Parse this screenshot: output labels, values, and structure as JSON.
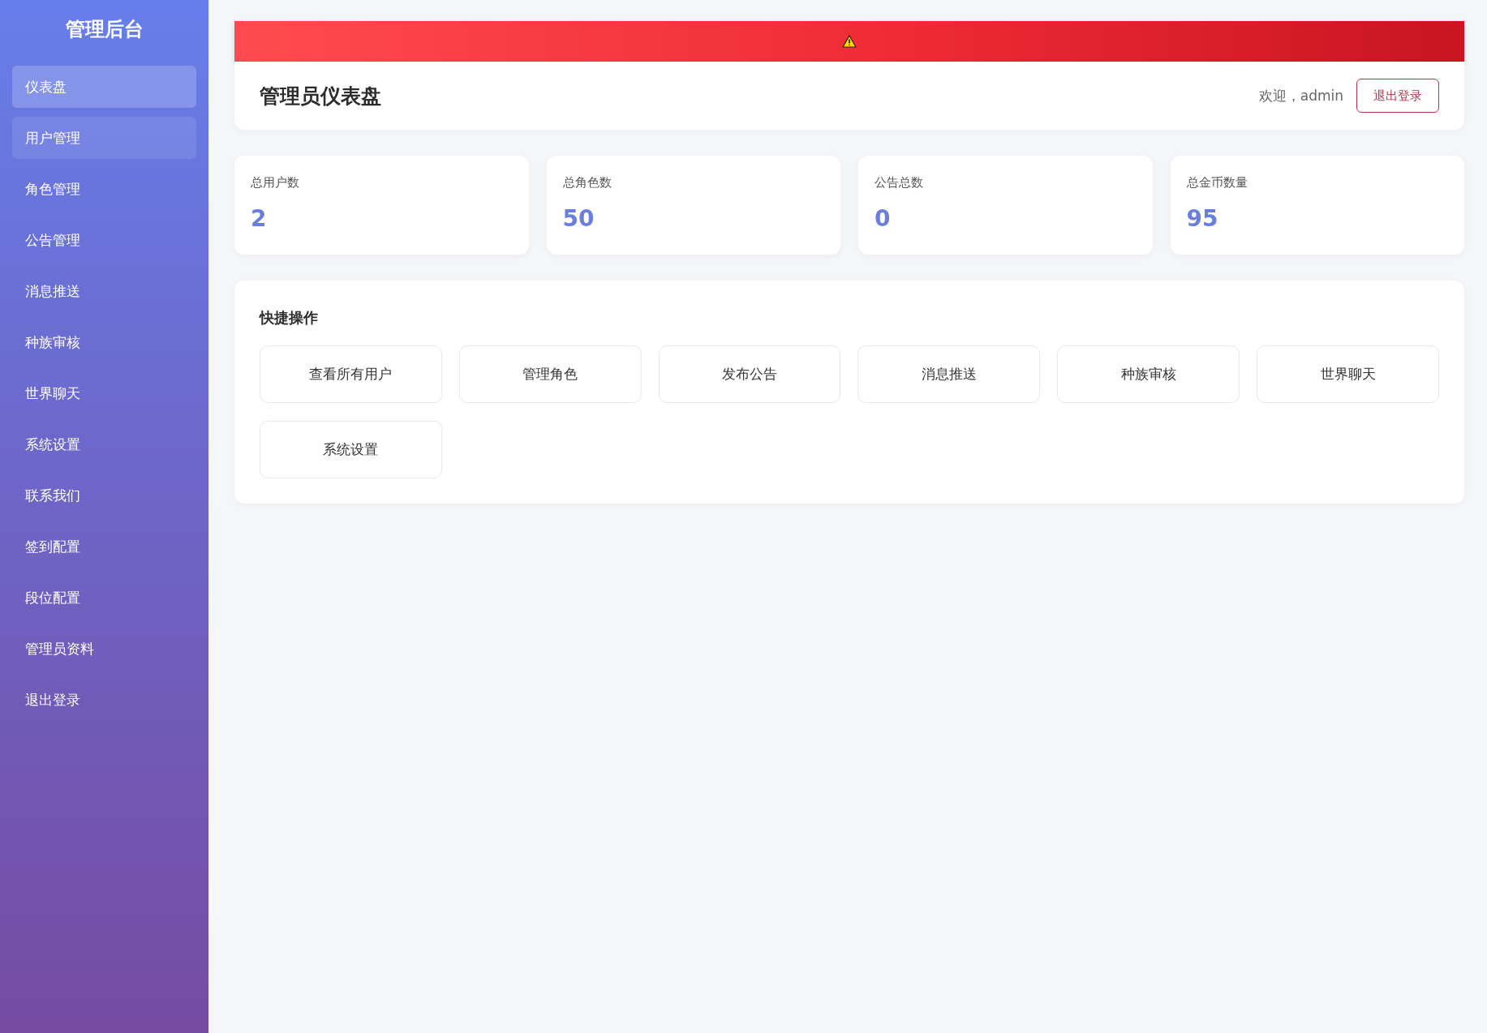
{
  "sidebar": {
    "title": "管理后台",
    "items": [
      {
        "label": "仪表盘",
        "selected": true,
        "hovered": false
      },
      {
        "label": "用户管理",
        "selected": false,
        "hovered": true
      },
      {
        "label": "角色管理",
        "selected": false,
        "hovered": false
      },
      {
        "label": "公告管理",
        "selected": false,
        "hovered": false
      },
      {
        "label": "消息推送",
        "selected": false,
        "hovered": false
      },
      {
        "label": "种族审核",
        "selected": false,
        "hovered": false
      },
      {
        "label": "世界聊天",
        "selected": false,
        "hovered": false
      },
      {
        "label": "系统设置",
        "selected": false,
        "hovered": false
      },
      {
        "label": "联系我们",
        "selected": false,
        "hovered": false
      },
      {
        "label": "签到配置",
        "selected": false,
        "hovered": false
      },
      {
        "label": "段位配置",
        "selected": false,
        "hovered": false
      },
      {
        "label": "管理员资料",
        "selected": false,
        "hovered": false
      },
      {
        "label": "退出登录",
        "selected": false,
        "hovered": false
      }
    ]
  },
  "header": {
    "title": "管理员仪表盘",
    "welcome": "欢迎，admin",
    "logout": "退出登录"
  },
  "stats": [
    {
      "label": "总用户数",
      "value": "2"
    },
    {
      "label": "总角色数",
      "value": "50"
    },
    {
      "label": "公告总数",
      "value": "0"
    },
    {
      "label": "总金币数量",
      "value": "95"
    }
  ],
  "quick_actions": {
    "title": "快捷操作",
    "buttons": [
      "查看所有用户",
      "管理角色",
      "发布公告",
      "消息推送",
      "种族审核",
      "世界聊天",
      "系统设置"
    ]
  }
}
